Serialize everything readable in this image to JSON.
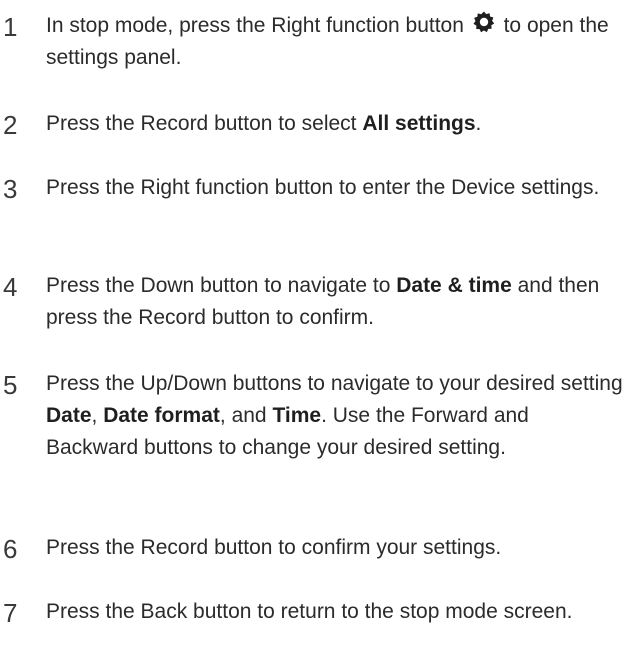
{
  "steps": [
    {
      "number": "1",
      "text_a": "In stop mode, press the Right function button",
      "icon": "gear-icon",
      "text_b": " to open the settings panel."
    },
    {
      "number": "2",
      "text_a": "Press the Record button to select ",
      "bold_a": "All settings",
      "text_b": "."
    },
    {
      "number": "3",
      "text_a": "Press the Right function button to enter the Device settings."
    },
    {
      "number": "4",
      "text_a": "Press the Down button to navigate to ",
      "bold_a": "Date & time",
      "text_b": " and then press the Record button to confirm."
    },
    {
      "number": "5",
      "text_a": "Press the Up/Down buttons to navigate to your desired setting ",
      "bold_a": "Date",
      "text_b": ", ",
      "bold_b": "Date format",
      "text_c": ", and ",
      "bold_c": "Time",
      "text_d": ". Use the Forward and Backward buttons to change your desired setting."
    },
    {
      "number": "6",
      "text_a": "Press the Record button to confirm your settings."
    },
    {
      "number": "7",
      "text_a": "Press the Back button to return to the stop mode screen."
    }
  ]
}
